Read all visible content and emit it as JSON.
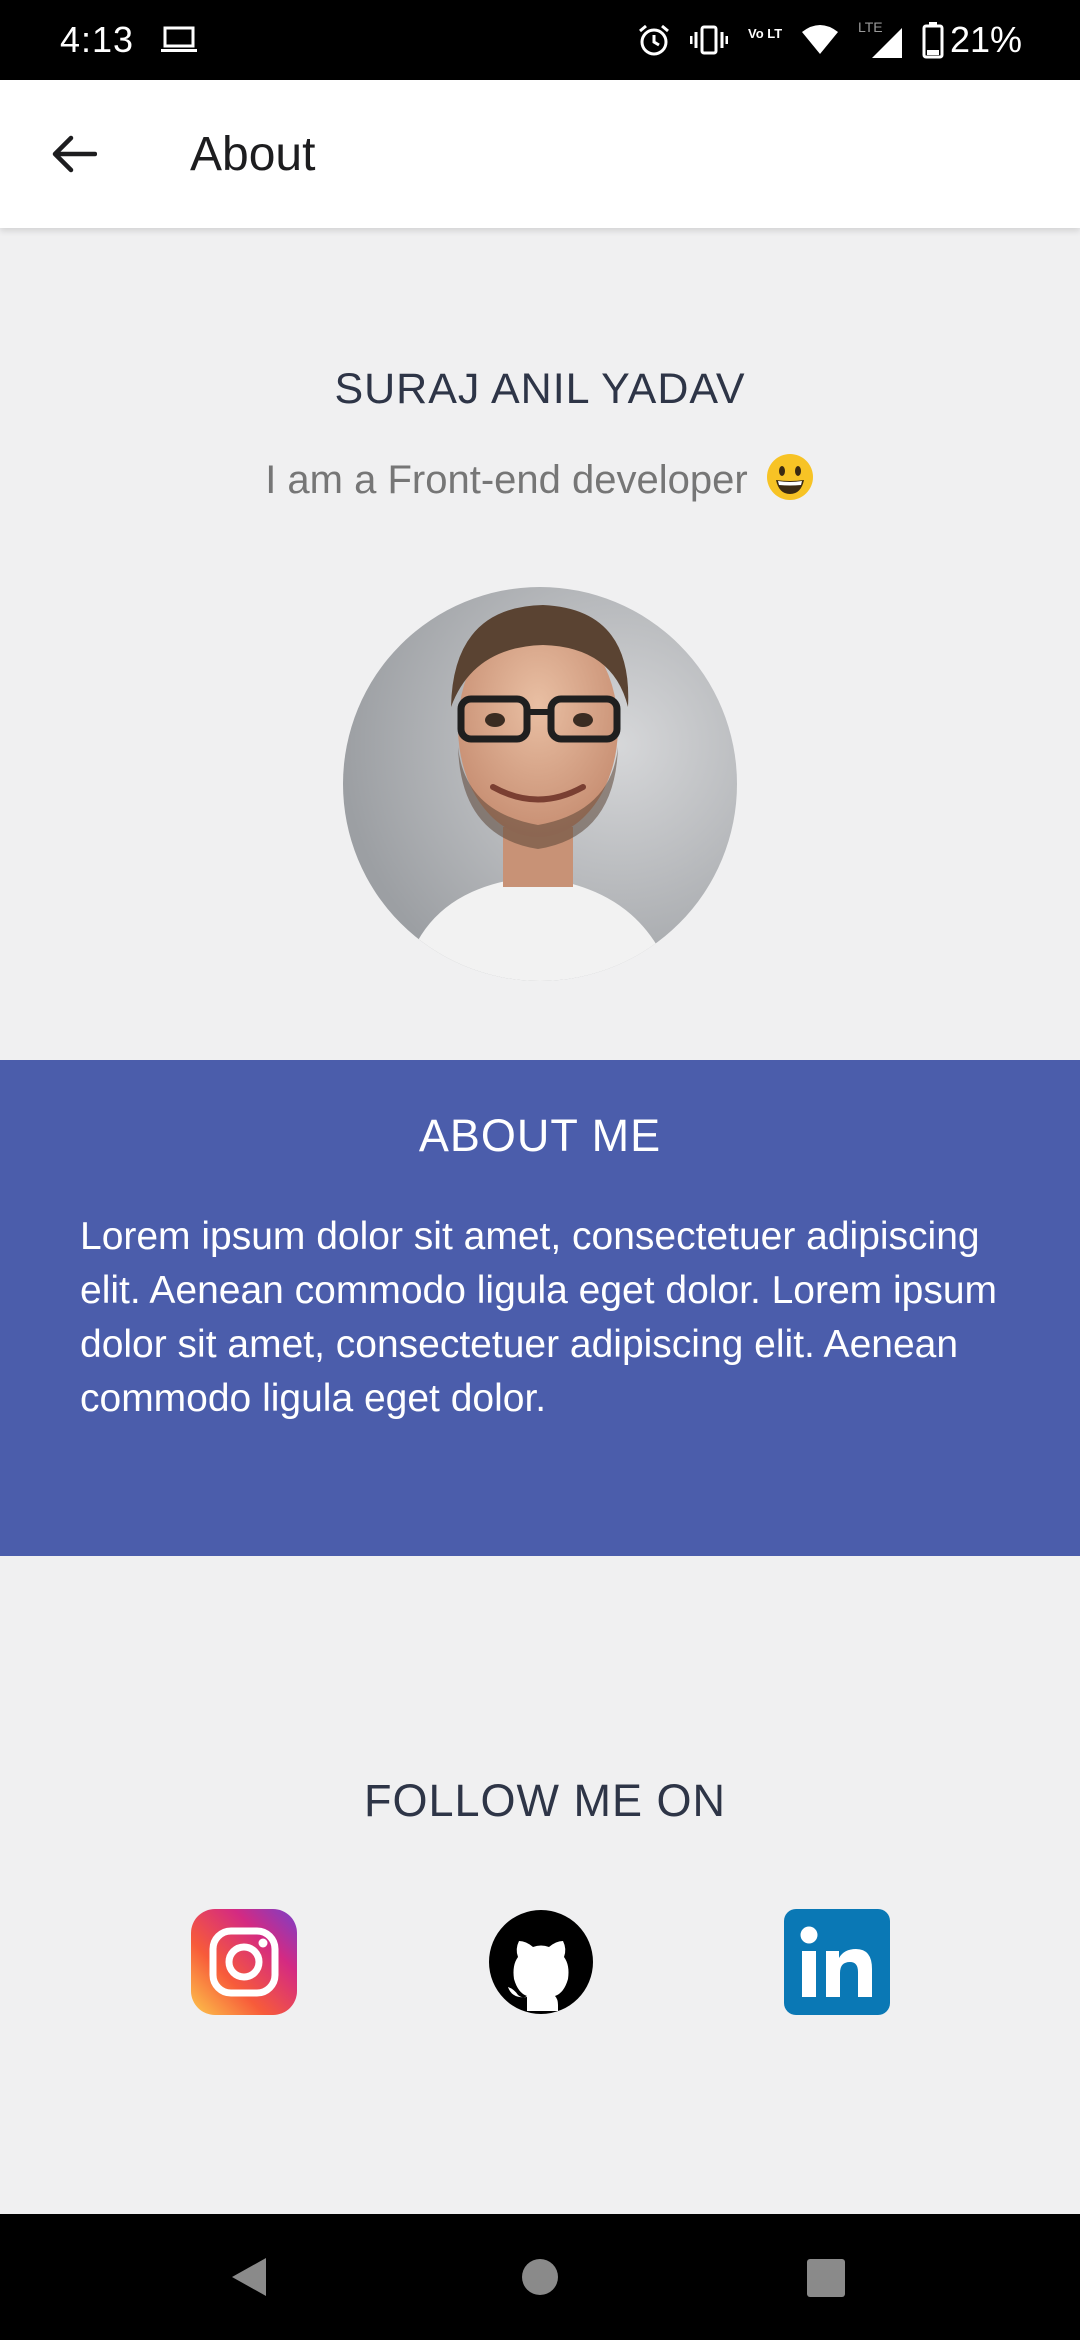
{
  "status_bar": {
    "time": "4:13",
    "battery_percent": "21%",
    "network_label": "LTE",
    "volte_label": "Vo LTE"
  },
  "app_bar": {
    "title": "About",
    "back_icon": "arrow-left-icon"
  },
  "profile": {
    "name": "SURAJ ANIL YADAV",
    "tagline": "I am a Front-end developer",
    "tagline_emoji": "grinning-face-emoji"
  },
  "about": {
    "heading": "ABOUT ME",
    "text": "Lorem ipsum dolor sit amet, consectetuer adipiscing elit. Aenean commodo ligula eget dolor. Lorem ipsum dolor sit amet, consectetuer adipiscing elit. Aenean commodo ligula eget dolor.",
    "background_color": "#4b5dab"
  },
  "follow": {
    "heading": "FOLLOW ME ON",
    "links": [
      {
        "icon": "instagram-icon"
      },
      {
        "icon": "github-icon"
      },
      {
        "icon": "linkedin-icon"
      }
    ]
  },
  "colors": {
    "page_background": "#f0f0f1",
    "accent": "#4b5dab",
    "heading_text": "#2e3547",
    "linkedin_blue": "#0a78b5"
  }
}
